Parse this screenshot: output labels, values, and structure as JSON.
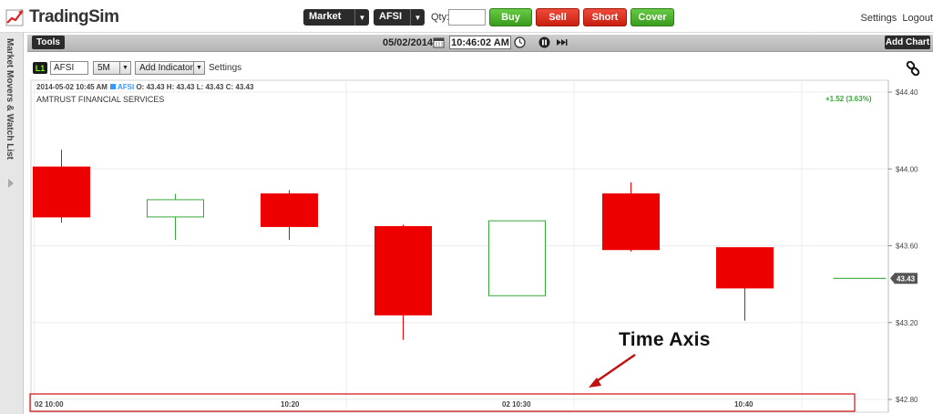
{
  "app": {
    "name": "TradingSim"
  },
  "order_bar": {
    "order_type": "Market",
    "symbol": "AFSI",
    "qty_label": "Qty:",
    "qty_value": "",
    "buttons": {
      "buy": "Buy",
      "sell": "Sell",
      "short": "Short",
      "cover": "Cover"
    },
    "colors": {
      "buy": "#3a9a1e",
      "sell": "#c81e10",
      "short": "#c81e10",
      "cover": "#3a9a1e"
    }
  },
  "top_links": {
    "settings": "Settings",
    "logout": "Logout"
  },
  "side_panel": {
    "label": "Market Movers & Watch List"
  },
  "toolbar": {
    "tools": "Tools",
    "date": "05/02/2014",
    "time": "10:46:02 AM",
    "add_chart": "Add Chart"
  },
  "chart_controls": {
    "layer": "L1",
    "symbol": "AFSI",
    "interval": "5M",
    "add_indicator": "Add Indicator",
    "settings": "Settings"
  },
  "chart_header": {
    "datetime": "2014-05-02 10:45 AM",
    "symbol": "AFSI",
    "ohlc": "O: 43.43  H: 43.43  L: 43.43  C: 43.43",
    "company": "AMTRUST FINANCIAL SERVICES",
    "change": "+1.52 (3.63%)"
  },
  "annotation": {
    "text": "Time Axis"
  },
  "chart_data": {
    "type": "candlestick",
    "up_color": "#3aa63a",
    "down_color": "#ee0000",
    "ylim": [
      42.8,
      44.4
    ],
    "yticks": [
      "$44.40",
      "$44.00",
      "$43.60",
      "$43.20",
      "$42.80"
    ],
    "ytick_values": [
      44.4,
      44.0,
      43.6,
      43.2,
      42.8
    ],
    "xticks": [
      "02 10:00",
      "10:20",
      "02 10:30",
      "10:40"
    ],
    "xtick_index": [
      0,
      2.5,
      4.5,
      6.5
    ],
    "last_price_label": "43.43",
    "last_price": 43.43,
    "candles": [
      {
        "o": 44.01,
        "h": 44.1,
        "l": 43.72,
        "c": 43.75
      },
      {
        "o": 43.75,
        "h": 43.87,
        "l": 43.63,
        "c": 43.84
      },
      {
        "o": 43.87,
        "h": 43.89,
        "l": 43.63,
        "c": 43.7
      },
      {
        "o": 43.7,
        "h": 43.71,
        "l": 43.11,
        "c": 43.24
      },
      {
        "o": 43.34,
        "h": 43.73,
        "l": 43.34,
        "c": 43.73
      },
      {
        "o": 43.87,
        "h": 43.93,
        "l": 43.57,
        "c": 43.58
      },
      {
        "o": 43.59,
        "h": 43.59,
        "l": 43.21,
        "c": 43.38
      },
      {
        "o": 43.43,
        "h": 43.43,
        "l": 43.43,
        "c": 43.43
      }
    ]
  }
}
